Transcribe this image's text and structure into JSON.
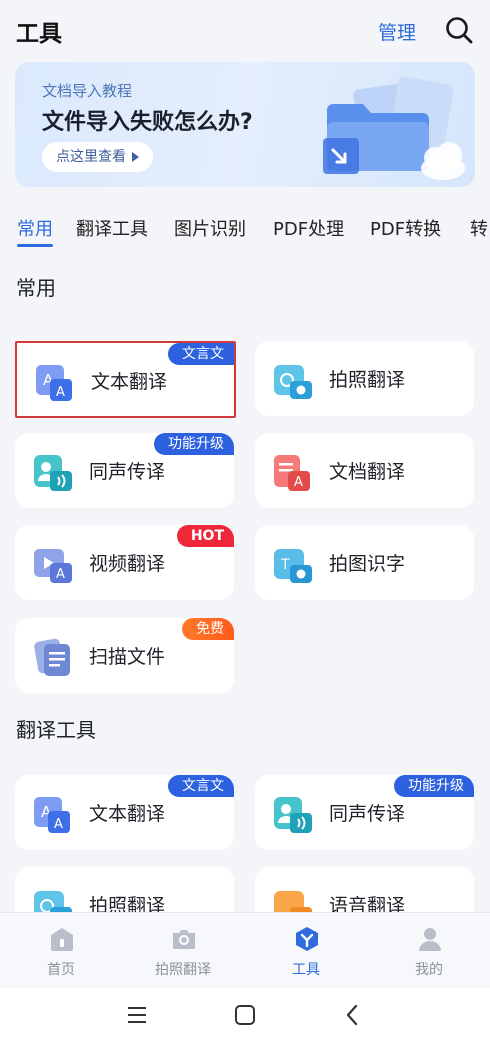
{
  "header": {
    "title": "工具",
    "manage_label": "管理",
    "search_icon": "search-icon"
  },
  "banner": {
    "subtitle": "文档导入教程",
    "title": "文件导入失败怎么办?",
    "button_label": "点这里查看"
  },
  "tabs": [
    {
      "label": "常用",
      "active": true
    },
    {
      "label": "翻译工具",
      "active": false
    },
    {
      "label": "图片识别",
      "active": false
    },
    {
      "label": "PDF处理",
      "active": false
    },
    {
      "label": "PDF转换",
      "active": false
    },
    {
      "label": "转",
      "active": false
    }
  ],
  "sections": {
    "common_title": "常用",
    "translate_title": "翻译工具"
  },
  "common_tools": [
    {
      "label": "文本翻译",
      "badge": "文言文",
      "icon": "text-translate-icon"
    },
    {
      "label": "拍照翻译",
      "badge": "",
      "icon": "photo-translate-icon"
    },
    {
      "label": "同声传译",
      "badge": "功能升级",
      "icon": "simultaneous-interpret-icon"
    },
    {
      "label": "文档翻译",
      "badge": "",
      "icon": "document-translate-icon"
    },
    {
      "label": "视频翻译",
      "badge": "HOT",
      "icon": "video-translate-icon"
    },
    {
      "label": "拍图识字",
      "badge": "",
      "icon": "photo-ocr-icon"
    },
    {
      "label": "扫描文件",
      "badge": "免费",
      "icon": "scan-file-icon"
    }
  ],
  "translate_tools": [
    {
      "label": "文本翻译",
      "badge": "文言文",
      "icon": "text-translate-icon"
    },
    {
      "label": "同声传译",
      "badge": "功能升级",
      "icon": "simultaneous-interpret-icon"
    },
    {
      "label": "拍照翻译",
      "badge": "",
      "icon": "photo-translate-icon"
    },
    {
      "label": "语音翻译",
      "badge": "",
      "icon": "voice-translate-icon"
    }
  ],
  "bottom_nav": [
    {
      "label": "首页",
      "icon": "home-icon",
      "active": false
    },
    {
      "label": "拍照翻译",
      "icon": "camera-icon",
      "active": false
    },
    {
      "label": "工具",
      "icon": "tools-icon",
      "active": true
    },
    {
      "label": "我的",
      "icon": "profile-icon",
      "active": false
    }
  ],
  "colors": {
    "accent": "#2f6bdc",
    "badge_blue": "#2e61e0",
    "badge_red": "#ee2739",
    "badge_orange": "#ff6a22",
    "selection_border": "#d23a3a"
  }
}
